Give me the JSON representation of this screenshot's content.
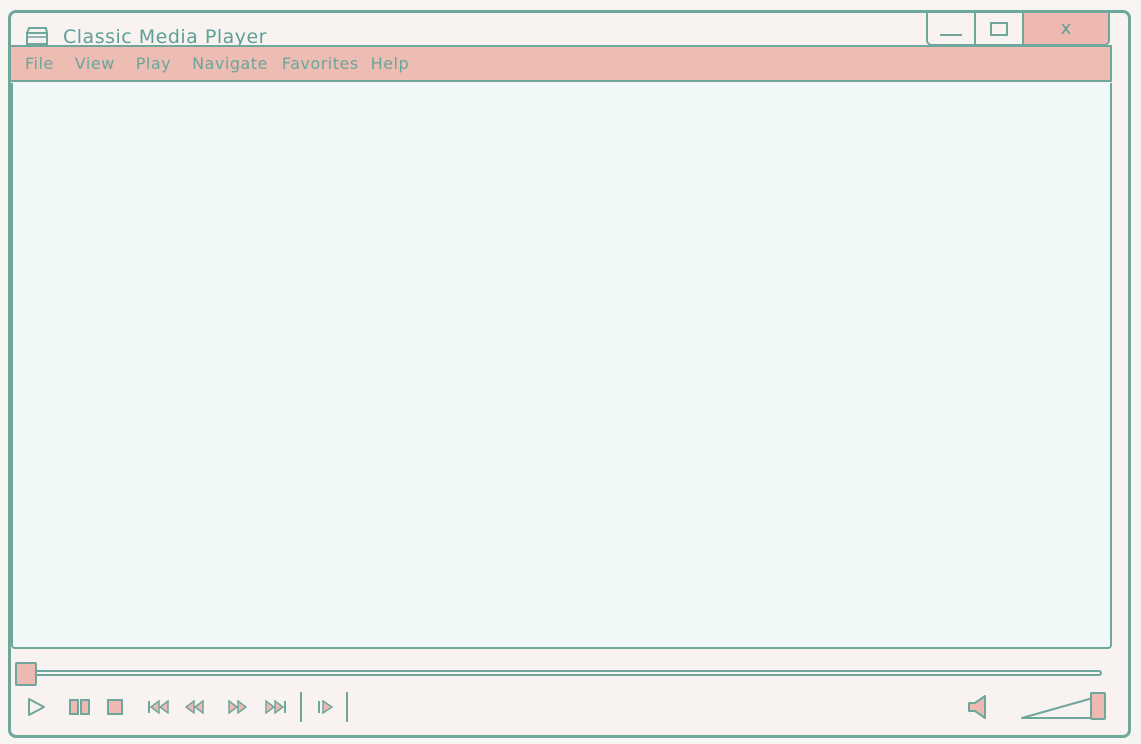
{
  "window": {
    "title": "Classic Media Player",
    "close_label": "x"
  },
  "menu": {
    "items": [
      {
        "label": "File"
      },
      {
        "label": "View"
      },
      {
        "label": "Play"
      },
      {
        "label": "Navigate"
      },
      {
        "label": "Favorites"
      },
      {
        "label": "Help"
      }
    ]
  },
  "playback": {
    "seek_progress": 0.0,
    "volume_level": 1.0,
    "controls": [
      "play-icon",
      "pause-icon",
      "stop-icon",
      "skip-previous-icon",
      "rewind-icon",
      "fast-forward-icon",
      "skip-next-icon",
      "frame-step-icon"
    ]
  },
  "colors": {
    "accent": "#6ea79c",
    "menubar": "#edbcb3",
    "video_bg": "#f1f8f8",
    "window_bg": "#f8f3f1"
  }
}
